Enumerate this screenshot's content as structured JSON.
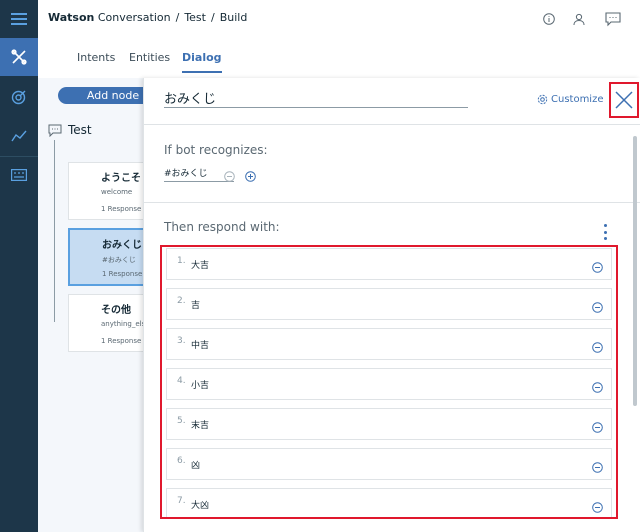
{
  "header": {
    "brand": "Watson",
    "product": "Conversation",
    "crumb_workspace": "Test",
    "crumb_page": "Build",
    "sep": "/"
  },
  "tabs": [
    {
      "label": "Intents",
      "active": false
    },
    {
      "label": "Entities",
      "active": false
    },
    {
      "label": "Dialog",
      "active": true
    }
  ],
  "canvas": {
    "add_node_label": "Add node",
    "skill_name": "Test",
    "nodes": [
      {
        "title": "ようこそ",
        "condition": "welcome",
        "responses": "1 Response",
        "selected": false
      },
      {
        "title": "おみくじ",
        "condition": "#おみくじ",
        "responses": "1 Response",
        "selected": true
      },
      {
        "title": "その他",
        "condition": "anything_else",
        "responses": "1 Response",
        "selected": false
      }
    ]
  },
  "panel": {
    "node_name": "おみくじ",
    "customize_label": "Customize",
    "if_label": "If bot recognizes:",
    "condition": "#おみくじ",
    "then_label": "Then respond with:",
    "responses": [
      {
        "num": "1.",
        "text": "大吉"
      },
      {
        "num": "2.",
        "text": "吉"
      },
      {
        "num": "3.",
        "text": "中吉"
      },
      {
        "num": "4.",
        "text": "小吉"
      },
      {
        "num": "5.",
        "text": "末吉"
      },
      {
        "num": "6.",
        "text": "凶"
      },
      {
        "num": "7.",
        "text": "大凶"
      }
    ]
  },
  "icons": {
    "rail": [
      "menu-icon",
      "tools-icon",
      "target-icon",
      "analytics-icon",
      "keyboard-icon"
    ],
    "header": [
      "info-icon",
      "user-icon",
      "chat-icon"
    ]
  },
  "colors": {
    "accent": "#3d70b2",
    "rail": "#1d3649",
    "highlight": "#e0182d",
    "selected_node": "#c6dcf2"
  }
}
